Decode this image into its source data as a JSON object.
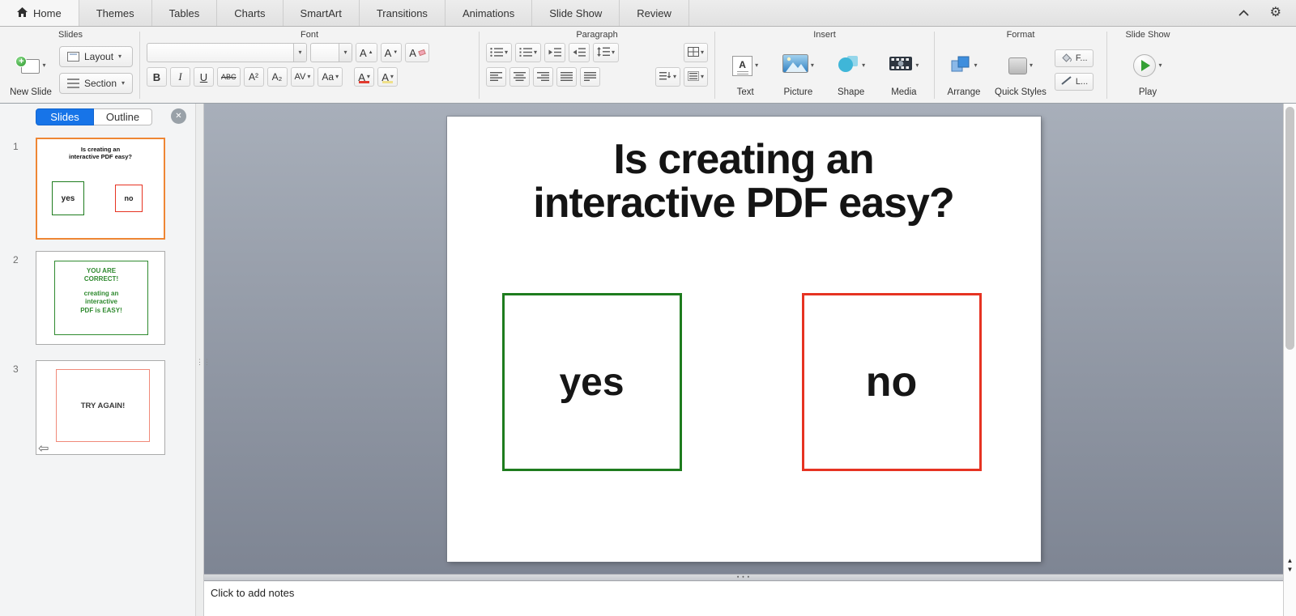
{
  "tabbar": {
    "tabs": [
      {
        "label": "Home"
      },
      {
        "label": "Themes"
      },
      {
        "label": "Tables"
      },
      {
        "label": "Charts"
      },
      {
        "label": "SmartArt"
      },
      {
        "label": "Transitions"
      },
      {
        "label": "Animations"
      },
      {
        "label": "Slide Show"
      },
      {
        "label": "Review"
      }
    ]
  },
  "ribbon": {
    "slides": {
      "label": "Slides",
      "new_slide_label": "New Slide",
      "layout_label": "Layout",
      "section_label": "Section"
    },
    "font": {
      "label": "Font",
      "bold": "B",
      "italic": "I",
      "underline": "U",
      "strikethrough": "ABC",
      "superscript": "A²",
      "subscript": "A₂",
      "char_spacing": "AV",
      "change_case": "Aa",
      "grow_font": "A",
      "shrink_font": "A",
      "clear_formatting": "A",
      "font_color": "A",
      "highlight_color": "A"
    },
    "paragraph": {
      "label": "Paragraph"
    },
    "insert": {
      "label": "Insert",
      "text_label": "Text",
      "picture_label": "Picture",
      "shape_label": "Shape",
      "media_label": "Media"
    },
    "format": {
      "label": "Format",
      "arrange_label": "Arrange",
      "quick_styles_label": "Quick Styles",
      "fill_label": "F...",
      "line_label": "L..."
    },
    "slideshow": {
      "label": "Slide Show",
      "play_label": "Play"
    }
  },
  "sidebar": {
    "slides_tab": "Slides",
    "outline_tab": "Outline",
    "thumbnails": [
      {
        "number": "1"
      },
      {
        "number": "2",
        "line1": "YOU ARE",
        "line2": "CORRECT!",
        "line3": "creating an",
        "line4": "interactive",
        "line5": "PDF is EASY!"
      },
      {
        "number": "3",
        "text": "TRY AGAIN!"
      }
    ]
  },
  "slide": {
    "title_line1": "Is creating an",
    "title_line2": "interactive PDF easy?",
    "yes": "yes",
    "no": "no"
  },
  "notes_placeholder": "Click to add notes",
  "icons": {
    "dropdown": "▾",
    "gear": "⚙",
    "close": "✕",
    "plus": "+",
    "tri_up": "▲",
    "tri_down": "▼",
    "back_arrow": "⇦",
    "grip_h": "• • •",
    "grip_v": "⋮⋮",
    "text_tool": "A",
    "scroll_up": "▲",
    "scroll_down": "▼"
  },
  "colors": {
    "yes_green": "#1e7c1e",
    "no_red": "#e63322",
    "selected_thumb_orange": "#ee8634",
    "slides_tab_blue": "#1774e8",
    "correct_green": "#2f8a2f",
    "try_again_salmon": "#f08a7a"
  }
}
